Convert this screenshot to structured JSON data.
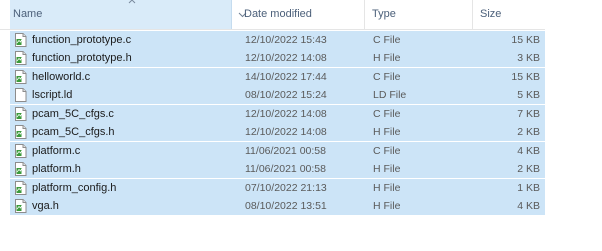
{
  "header": {
    "name": "Name",
    "date_modified": "Date modified",
    "type": "Type",
    "size": "Size"
  },
  "colors": {
    "selection": "#cce4f7",
    "header_active": "#d9ebf9",
    "header_text": "#4c607a"
  },
  "files": [
    {
      "name": "function_prototype.c",
      "date": "12/10/2022 15:43",
      "type": "C File",
      "size": "15 KB",
      "icon": "source-file-icon"
    },
    {
      "name": "function_prototype.h",
      "date": "12/10/2022 14:08",
      "type": "H File",
      "size": "3 KB",
      "icon": "source-file-icon"
    },
    {
      "name": "helloworld.c",
      "date": "14/10/2022 17:44",
      "type": "C File",
      "size": "15 KB",
      "icon": "source-file-icon"
    },
    {
      "name": "lscript.ld",
      "date": "08/10/2022 15:24",
      "type": "LD File",
      "size": "5 KB",
      "icon": "blank-file-icon"
    },
    {
      "name": "pcam_5C_cfgs.c",
      "date": "12/10/2022 14:08",
      "type": "C File",
      "size": "7 KB",
      "icon": "source-file-icon"
    },
    {
      "name": "pcam_5C_cfgs.h",
      "date": "12/10/2022 14:08",
      "type": "H File",
      "size": "2 KB",
      "icon": "source-file-icon"
    },
    {
      "name": "platform.c",
      "date": "11/06/2021 00:58",
      "type": "C File",
      "size": "4 KB",
      "icon": "source-file-icon"
    },
    {
      "name": "platform.h",
      "date": "11/06/2021 00:58",
      "type": "H File",
      "size": "2 KB",
      "icon": "source-file-icon"
    },
    {
      "name": "platform_config.h",
      "date": "07/10/2022 21:13",
      "type": "H File",
      "size": "1 KB",
      "icon": "source-file-icon"
    },
    {
      "name": "vga.h",
      "date": "08/10/2022 13:51",
      "type": "H File",
      "size": "4 KB",
      "icon": "source-file-icon"
    }
  ]
}
